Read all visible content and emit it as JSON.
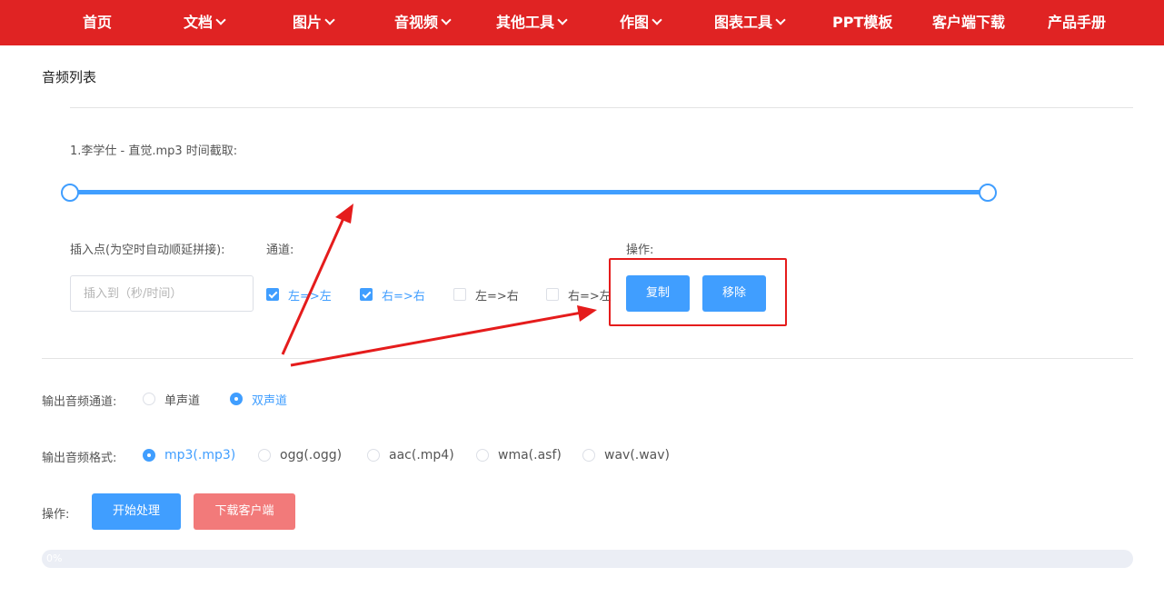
{
  "nav": {
    "items": [
      {
        "label": "首页",
        "has_dropdown": false
      },
      {
        "label": "文档",
        "has_dropdown": true
      },
      {
        "label": "图片",
        "has_dropdown": true
      },
      {
        "label": "音视频",
        "has_dropdown": true
      },
      {
        "label": "其他工具",
        "has_dropdown": true
      },
      {
        "label": "作图",
        "has_dropdown": true
      },
      {
        "label": "图表工具",
        "has_dropdown": true
      },
      {
        "label": "PPT模板",
        "has_dropdown": false
      },
      {
        "label": "客户端下载",
        "has_dropdown": false
      },
      {
        "label": "产品手册",
        "has_dropdown": false
      }
    ]
  },
  "section": {
    "title": "音频列表"
  },
  "audio_item": {
    "label": "1.李学仕 - 直觉.mp3 时间截取:",
    "insert_label": "插入点(为空时自动顺延拼接):",
    "insert_placeholder": "插入到（秒/时间）",
    "insert_value": "",
    "channel_label": "通道:",
    "channels": [
      {
        "label": "左=>左",
        "checked": true
      },
      {
        "label": "右=>右",
        "checked": true
      },
      {
        "label": "左=>右",
        "checked": false
      },
      {
        "label": "右=>左",
        "checked": false
      }
    ],
    "ops_label": "操作:",
    "copy_button": "复制",
    "remove_button": "移除"
  },
  "output_channel": {
    "label": "输出音频通道:",
    "options": [
      {
        "label": "单声道",
        "selected": false
      },
      {
        "label": "双声道",
        "selected": true
      }
    ]
  },
  "output_format": {
    "label": "输出音频格式:",
    "options": [
      {
        "label": "mp3(.mp3)",
        "selected": true
      },
      {
        "label": "ogg(.ogg)",
        "selected": false
      },
      {
        "label": "aac(.mp4)",
        "selected": false
      },
      {
        "label": "wma(.asf)",
        "selected": false
      },
      {
        "label": "wav(.wav)",
        "selected": false
      }
    ]
  },
  "actions": {
    "label": "操作:",
    "start_button": "开始处理",
    "download_button": "下载客户端"
  },
  "progress": {
    "text": "0%",
    "value": 0
  },
  "colors": {
    "nav_bg": "#e02323",
    "accent": "#409eff",
    "download_button": "#f27a7a",
    "annotation": "#e51c1c"
  }
}
